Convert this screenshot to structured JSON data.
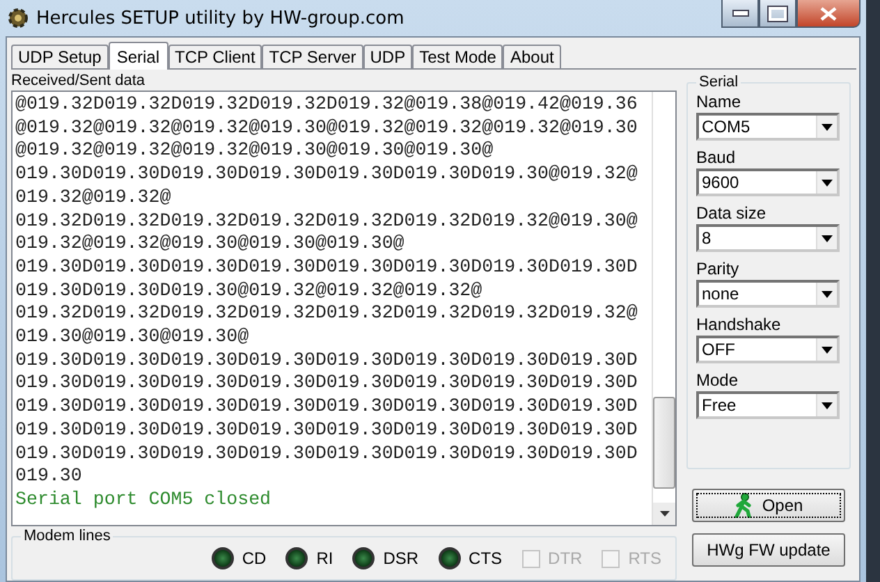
{
  "window": {
    "title": "Hercules SETUP utility by HW-group.com"
  },
  "tabs": [
    {
      "label": "UDP Setup",
      "selected": false
    },
    {
      "label": "Serial",
      "selected": true
    },
    {
      "label": "TCP Client",
      "selected": false
    },
    {
      "label": "TCP Server",
      "selected": false
    },
    {
      "label": "UDP",
      "selected": false
    },
    {
      "label": "Test Mode",
      "selected": false
    },
    {
      "label": "About",
      "selected": false
    }
  ],
  "log": {
    "label": "Received/Sent data",
    "lines": [
      {
        "kind": "data",
        "text": "@019.32D019.32D019.32D019.32D019.32@019.38@019.42@019.36"
      },
      {
        "kind": "data",
        "text": "@019.32@019.32@019.32@019.30@019.32@019.32@019.32@019.30"
      },
      {
        "kind": "data",
        "text": "@019.32@019.32@019.32@019.30@019.30@019.30@"
      },
      {
        "kind": "data",
        "text": "019.30D019.30D019.30D019.30D019.30D019.30D019.30@019.32@"
      },
      {
        "kind": "data",
        "text": "019.32@019.32@"
      },
      {
        "kind": "data",
        "text": "019.32D019.32D019.32D019.32D019.32D019.32D019.32@019.30@"
      },
      {
        "kind": "data",
        "text": "019.32@019.32@019.30@019.30@019.30@"
      },
      {
        "kind": "data",
        "text": "019.30D019.30D019.30D019.30D019.30D019.30D019.30D019.30D"
      },
      {
        "kind": "data",
        "text": "019.30D019.30D019.30@019.32@019.32@019.32@"
      },
      {
        "kind": "data",
        "text": "019.32D019.32D019.32D019.32D019.32D019.32D019.32D019.32@"
      },
      {
        "kind": "data",
        "text": "019.30@019.30@019.30@"
      },
      {
        "kind": "data",
        "text": "019.30D019.30D019.30D019.30D019.30D019.30D019.30D019.30D"
      },
      {
        "kind": "data",
        "text": "019.30D019.30D019.30D019.30D019.30D019.30D019.30D019.30D"
      },
      {
        "kind": "data",
        "text": "019.30D019.30D019.30D019.30D019.30D019.30D019.30D019.30D"
      },
      {
        "kind": "data",
        "text": "019.30D019.30D019.30D019.30D019.30D019.30D019.30D019.30D"
      },
      {
        "kind": "data",
        "text": "019.30D019.30D019.30D019.30D019.30D019.30D019.30D019.30D"
      },
      {
        "kind": "data",
        "text": "019.30"
      },
      {
        "kind": "status",
        "text": "Serial port COM5 closed"
      }
    ]
  },
  "serial": {
    "title": "Serial",
    "fields": [
      {
        "label": "Name",
        "value": "COM5"
      },
      {
        "label": "Baud",
        "value": "9600"
      },
      {
        "label": "Data size",
        "value": "8"
      },
      {
        "label": "Parity",
        "value": "none"
      },
      {
        "label": "Handshake",
        "value": "OFF"
      },
      {
        "label": "Mode",
        "value": "Free"
      }
    ]
  },
  "buttons": [
    {
      "kind": "open",
      "label": "Open"
    },
    {
      "kind": "plain",
      "label": "HWg FW update"
    }
  ],
  "modem_lines": {
    "title": "Modem lines",
    "signals": [
      {
        "kind": "led",
        "label": "CD",
        "on": true
      },
      {
        "kind": "led",
        "label": "RI",
        "on": true
      },
      {
        "kind": "led",
        "label": "DSR",
        "on": true
      },
      {
        "kind": "led",
        "label": "CTS",
        "on": true
      },
      {
        "kind": "checkbox",
        "label": "DTR",
        "checked": false,
        "disabled": true
      },
      {
        "kind": "checkbox",
        "label": "RTS",
        "checked": false,
        "disabled": true
      }
    ]
  }
}
